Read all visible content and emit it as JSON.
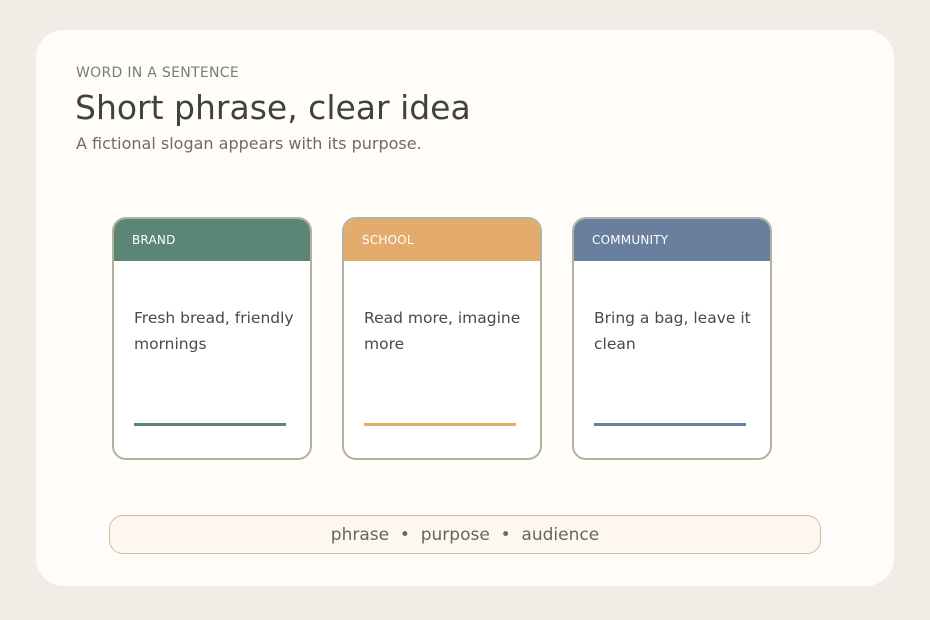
{
  "header": {
    "eyebrow": "WORD IN A SENTENCE",
    "title": "Short phrase, clear idea",
    "subtitle": "A fictional slogan appears with its purpose."
  },
  "cards": [
    {
      "label": "BRAND",
      "text": "Fresh bread, friendly mornings",
      "color": "#5b8574"
    },
    {
      "label": "SCHOOL",
      "text": "Read more, imagine more",
      "color": "#e3ac6c"
    },
    {
      "label": "COMMUNITY",
      "text": "Bring a bag, leave it clean",
      "color": "#6a7f9d"
    }
  ],
  "legend": {
    "items": [
      "phrase",
      "purpose",
      "audience"
    ],
    "separator": "•",
    "text": "phrase  •  purpose  •  audience"
  }
}
